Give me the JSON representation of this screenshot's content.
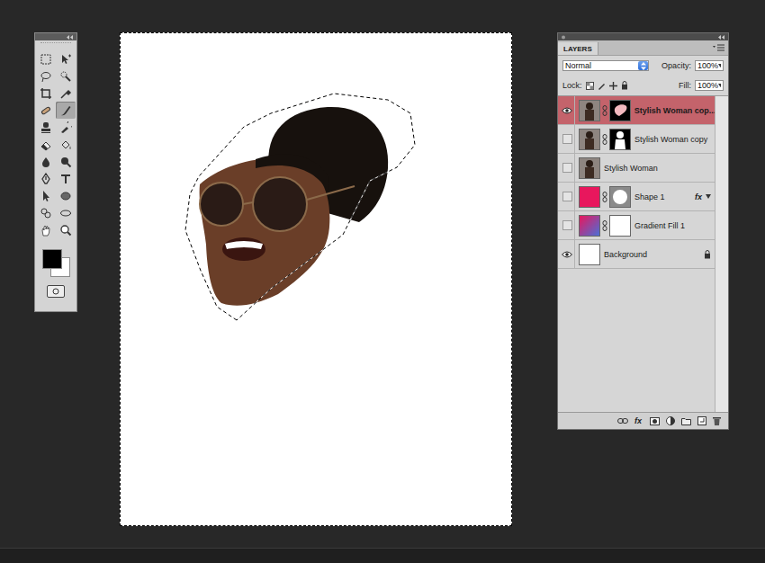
{
  "toolbox": {
    "tools": [
      {
        "selected": false
      },
      {
        "selected": false
      },
      {
        "selected": false
      },
      {
        "selected": false
      },
      {
        "selected": false
      },
      {
        "selected": false
      },
      {
        "selected": false
      },
      {
        "selected": true
      },
      {
        "selected": false
      },
      {
        "selected": false
      },
      {
        "selected": false
      },
      {
        "selected": false
      },
      {
        "selected": false
      },
      {
        "selected": false
      },
      {
        "selected": false
      },
      {
        "selected": false
      },
      {
        "selected": false
      },
      {
        "selected": false
      },
      {
        "selected": false
      },
      {
        "selected": false
      },
      {
        "selected": false
      },
      {
        "selected": false
      }
    ],
    "foreground": "#000000",
    "background": "#ffffff"
  },
  "canvas": {
    "all_selected": true
  },
  "layers_panel": {
    "tab": "LAYERS",
    "blend_mode": "Normal",
    "opacity_label": "Opacity:",
    "opacity": "100%",
    "lock_label": "Lock:",
    "fill_label": "Fill:",
    "fill": "100%",
    "layers": [
      {
        "name": "Stylish Woman cop...",
        "visible": true,
        "selected": true,
        "locked": false,
        "linked": true,
        "kind": "photo",
        "mask": "selection"
      },
      {
        "name": "Stylish Woman copy",
        "visible": false,
        "selected": false,
        "locked": false,
        "linked": true,
        "kind": "photo",
        "mask": "silhouette"
      },
      {
        "name": "Stylish Woman",
        "visible": false,
        "selected": false,
        "locked": false,
        "linked": false,
        "kind": "photo",
        "mask": "none"
      },
      {
        "name": "Shape 1",
        "visible": false,
        "selected": false,
        "locked": false,
        "linked": true,
        "kind": "shape",
        "mask": "circle",
        "color": "#e8175d",
        "effects": "fx"
      },
      {
        "name": "Gradient Fill 1",
        "visible": false,
        "selected": false,
        "locked": false,
        "linked": true,
        "kind": "gradient",
        "mask": "white",
        "colors": [
          "#e8175d",
          "#4b6fd6"
        ]
      },
      {
        "name": "Background",
        "visible": true,
        "selected": false,
        "locked": true,
        "linked": false,
        "kind": "background",
        "mask": "none",
        "color": "#ffffff"
      }
    ],
    "footer": {
      "effects_label": "fx"
    }
  }
}
